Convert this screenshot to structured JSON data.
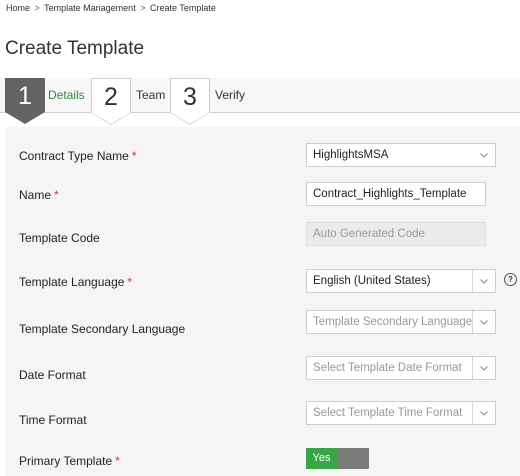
{
  "breadcrumb": {
    "home": "Home",
    "separator": ">",
    "section": "Template Management",
    "current": "Create Template"
  },
  "page": {
    "title": "Create Template"
  },
  "wizard": {
    "steps": [
      {
        "number": "1",
        "label": "Details",
        "state": "active"
      },
      {
        "number": "2",
        "label": "Team",
        "state": "inactive"
      },
      {
        "number": "3",
        "label": "Verify",
        "state": "inactive"
      }
    ]
  },
  "form": {
    "contract_type": {
      "label": "Contract Type Name",
      "required_mark": "*",
      "value": "HighlightsMSA",
      "icon": "chevron-down-icon"
    },
    "name": {
      "label": "Name",
      "required_mark": "*",
      "value": "Contract_Highlights_Template"
    },
    "template_code": {
      "label": "Template Code",
      "placeholder": "Auto Generated Code"
    },
    "template_language": {
      "label": "Template Language",
      "required_mark": "*",
      "value": "English (United States)",
      "icon": "chevron-down-icon",
      "help_icon": "question-circle-icon",
      "help_glyph": "?"
    },
    "secondary_language": {
      "label": "Template Secondary Language",
      "placeholder": "Template Secondary Language",
      "icon": "chevron-down-icon"
    },
    "date_format": {
      "label": "Date Format",
      "placeholder": "Select Template Date Format",
      "icon": "chevron-down-icon"
    },
    "time_format": {
      "label": "Time Format",
      "placeholder": "Select Template Time Format",
      "icon": "chevron-down-icon"
    },
    "primary_template": {
      "label": "Primary Template",
      "required_mark": "*",
      "toggle_label": "Yes",
      "toggle_on": true
    }
  },
  "colors": {
    "accent_green": "#3aa547",
    "step_label_green": "#2e8b3e",
    "active_step": "#636363",
    "required": "#d9342b"
  }
}
